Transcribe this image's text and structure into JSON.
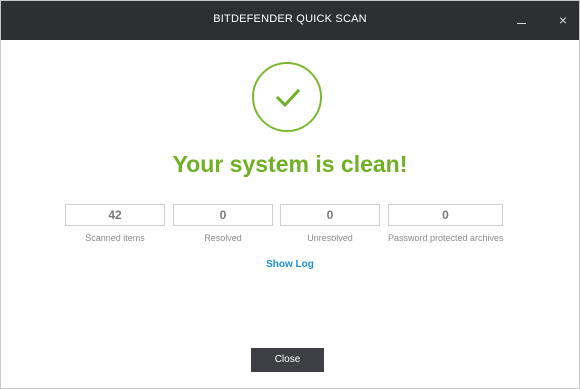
{
  "window": {
    "title": "BITDEFENDER QUICK SCAN",
    "minimize_icon": "minimize-icon",
    "close_icon": "×"
  },
  "result": {
    "icon": "checkmark-icon",
    "headline": "Your system is clean!",
    "accent_color": "#6fb024"
  },
  "stats": [
    {
      "value": "42",
      "label": "Scanned items"
    },
    {
      "value": "0",
      "label": "Resolved"
    },
    {
      "value": "0",
      "label": "Unresolved"
    },
    {
      "value": "0",
      "label": "Password protected archives"
    }
  ],
  "links": {
    "show_log": "Show Log"
  },
  "footer": {
    "close_label": "Close"
  }
}
